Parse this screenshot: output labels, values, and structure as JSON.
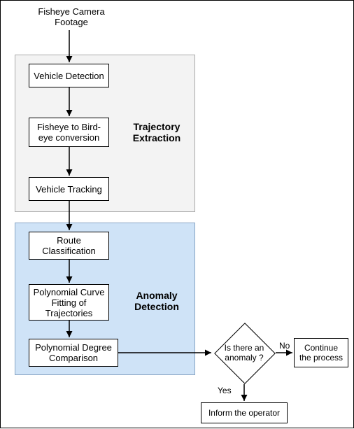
{
  "input": {
    "label": "Fisheye Camera\nFootage"
  },
  "trajectory": {
    "section_label": "Trajectory\nExtraction",
    "detect": "Vehicle Detection",
    "convert": "Fisheye to Bird-\neye conversion",
    "track": "Vehicle Tracking"
  },
  "anomaly": {
    "section_label": "Anomaly\nDetection",
    "route": "Route\nClassification",
    "fit": "Polynomial Curve\nFitting of\nTrajectories",
    "compare": "Polynomial Degree\nComparison"
  },
  "decision": {
    "question": "Is there an\nanomaly ?",
    "no": "No",
    "yes": "Yes"
  },
  "continue_box": "Continue\nthe process",
  "inform_box": "Inform the operator"
}
